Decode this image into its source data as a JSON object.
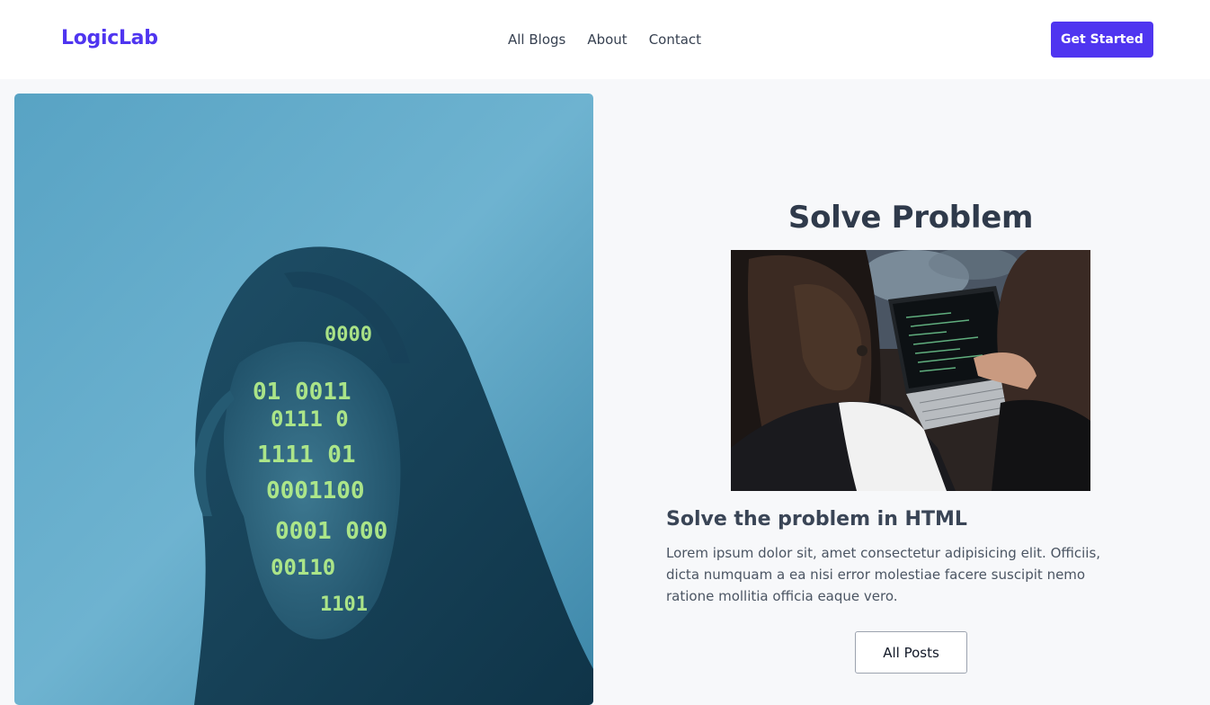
{
  "navbar": {
    "brand": "LogicLab",
    "links": [
      "All Blogs",
      "About",
      "Contact"
    ],
    "cta_label": "Get Started"
  },
  "hero": {
    "image_alt": "Woman with binary code projected on her face",
    "code_rows": [
      "0000",
      "01 0011",
      "0111 0",
      "1111 01",
      "0001100",
      "0001 000",
      "00110",
      "1101"
    ]
  },
  "feature": {
    "title": "Solve Problem",
    "image_alt": "Two women looking at code on a laptop",
    "post_heading": "Solve the problem in HTML",
    "post_text": "Lorem ipsum dolor sit, amet consectetur adipisicing elit. Officiis, dicta numquam a ea nisi error molestiae facere suscipit nemo ratione mollitia officia eaque vero.",
    "button_label": "All Posts"
  },
  "colors": {
    "brand": "#4f35f0",
    "page_bg": "#f7f8fa",
    "hero_bg": "#5ba5c6",
    "code_green": "#b6f08a"
  }
}
